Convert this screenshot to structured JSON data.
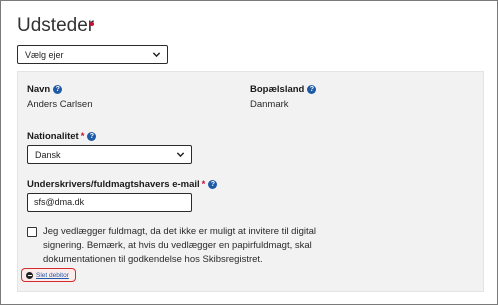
{
  "section": {
    "title": "Udsteder"
  },
  "owner_select": {
    "value": "Vælg ejer"
  },
  "panel": {
    "name_label": "Navn",
    "name_value": "Anders Carlsen",
    "residence_label": "Bopælsland",
    "residence_value": "Danmark",
    "nationality_label": "Nationalitet",
    "nationality_required": "*",
    "nationality_value": "Dansk",
    "email_label": "Underskrivers/fuldmagtshavers e-mail",
    "email_required": "*",
    "email_value": "sfs@dma.dk",
    "checkbox_text": "Jeg vedlægger fuldmagt, da det ikke er muligt at invitere til digital signering. Bemærk, at hvis du vedlægger en papirfuldmagt, skal dokumentationen til godkendelse hos Skibsregistret.",
    "checkbox_checked": false,
    "delete_label": "Slet debitor"
  },
  "icons": {
    "help": "help-circle-icon",
    "chevron": "chevron-down-icon",
    "delete": "minus-circle-icon"
  },
  "colors": {
    "accent": "#1f5aa8",
    "required": "#c8102e",
    "panel_bg": "#f2f2f2",
    "highlight": "#d62b2b"
  }
}
